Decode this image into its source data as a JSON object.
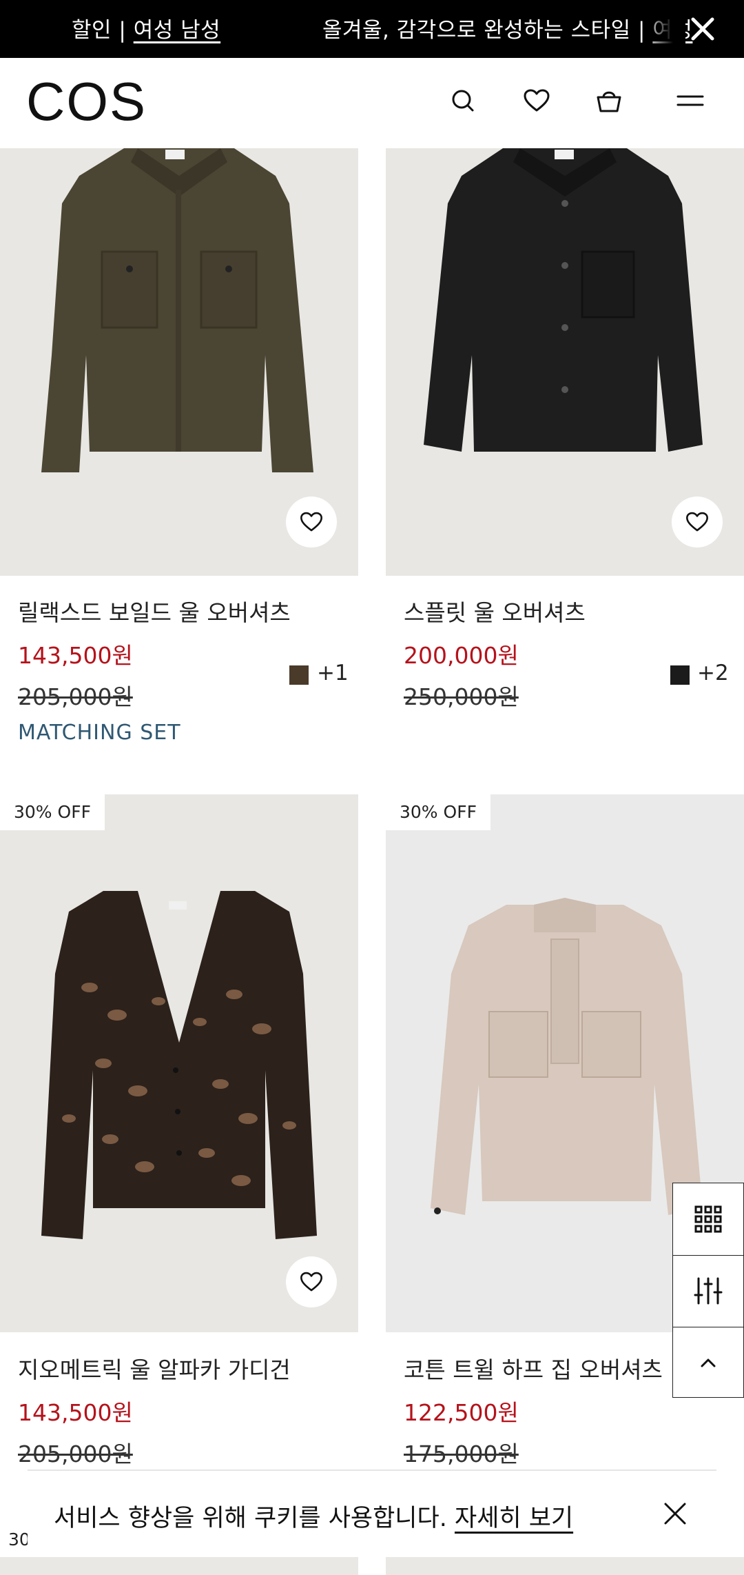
{
  "announcement": {
    "text_left_prefix": "할인 | ",
    "text_left_link": "여성 남성",
    "text_right_prefix": "올겨울, 감각으로 완성하는 스타일 | ",
    "text_right_link": "여성"
  },
  "header": {
    "logo": "COS",
    "icons": [
      "search-icon",
      "heart-icon",
      "bag-icon",
      "menu-icon"
    ]
  },
  "products": [
    {
      "name": "릴랙스드 보일드 울 오버셔츠",
      "price": "143,500원",
      "original_price": "205,000원",
      "swatch_color": "#4a3a2a",
      "swatch_more": "+1",
      "label": "MATCHING SET"
    },
    {
      "name": "스플릿 울 오버셔츠",
      "price": "200,000원",
      "original_price": "250,000원",
      "swatch_color": "#1b1b1b",
      "swatch_more": "+2"
    },
    {
      "badge": "30% OFF",
      "name": "지오메트릭 울 알파카 가디건",
      "price": "143,500원",
      "original_price": "205,000원"
    },
    {
      "badge": "30% OFF",
      "name": "코튼 트윌 하프 집 오버셔츠",
      "price": "122,500원",
      "original_price": "175,000원"
    }
  ],
  "peek_badge": "30",
  "cookie": {
    "message": "서비스 향상을 위해 쿠키를 사용합니다. ",
    "link": "자세히 보기"
  },
  "colors": {
    "sale_red": "#b5121b",
    "label_blue": "#2f5873"
  }
}
